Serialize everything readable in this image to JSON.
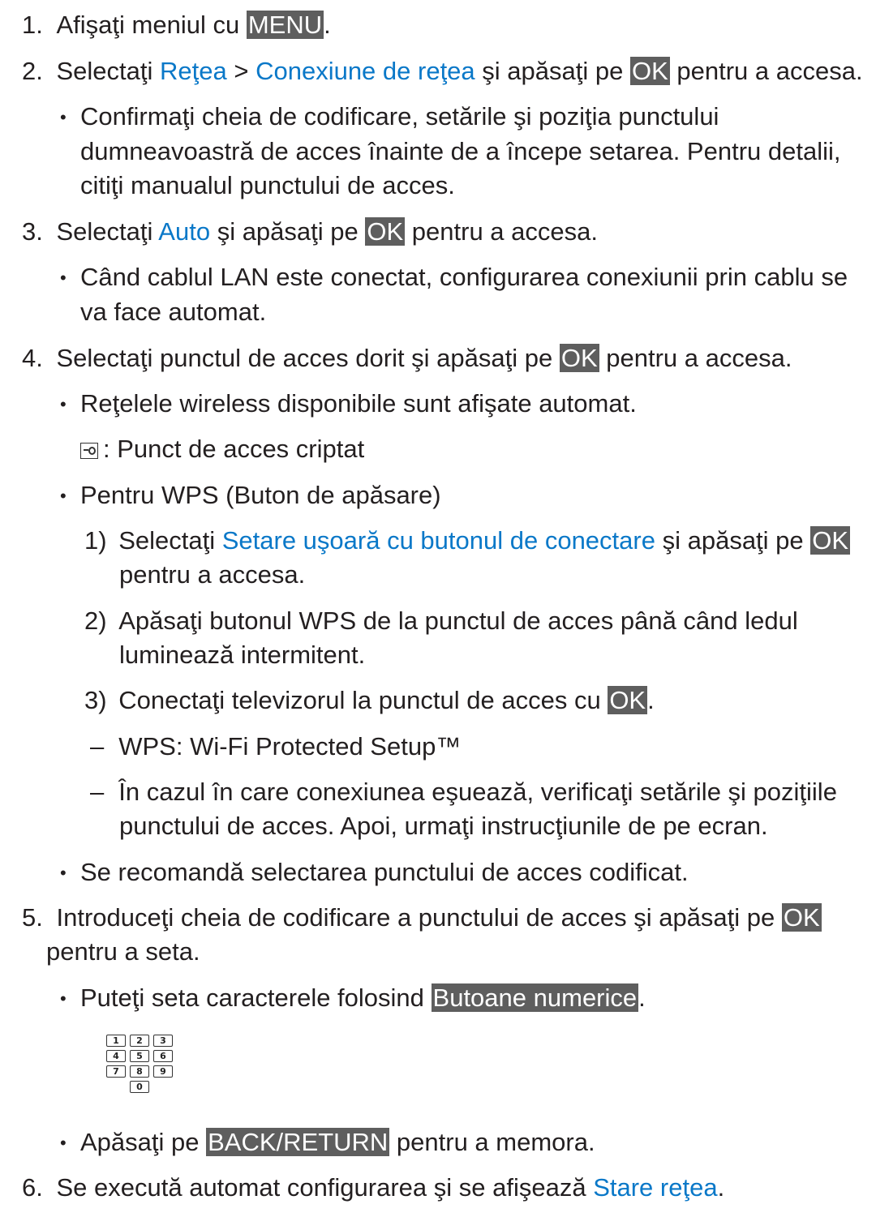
{
  "steps": [
    {
      "n": "1.",
      "pre": "Afişaţi meniul cu ",
      "key": "MENU",
      "post": "."
    },
    {
      "n": "2.",
      "pre": "Selectaţi ",
      "link1": "Reţea",
      "sep": " > ",
      "link2": "Conexiune de reţea",
      "mid": " şi apăsaţi pe ",
      "key": "OK",
      "post": " pentru a accesa."
    },
    {
      "n": "3.",
      "pre": "Selectaţi ",
      "link": "Auto",
      "mid": " şi apăsaţi pe ",
      "key": "OK",
      "post": " pentru a accesa."
    },
    {
      "n": "4.",
      "pre": "Selectaţi punctul de acces dorit şi apăsaţi pe ",
      "key": "OK",
      "post": " pentru a accesa."
    },
    {
      "n": "5.",
      "pre": "Introduceţi cheia de codificare a punctului de acces şi apăsaţi pe ",
      "key": "OK",
      "l2": "pentru a seta."
    },
    {
      "n": "6.",
      "pre": "Se execută automat configurarea şi se afişează ",
      "link": "Stare reţea",
      "post": "."
    }
  ],
  "step2_note": [
    "Confirmaţi cheia de codificare, setările şi poziţia punctului",
    "dumneavoastră de acces înainte de a începe setarea. Pentru detalii,",
    "citiţi manualul punctului de acces."
  ],
  "step3_note": [
    "Când cablul LAN este conectat, configurarea conexiunii prin cablu se",
    "va face automat."
  ],
  "step4": {
    "note1": "Reţelele wireless disponibile sunt afişate automat.",
    "lock_icon": "lock-icon",
    "lock_text": ": Punct de acces criptat",
    "note2": "Pentru WPS (Buton de apăsare)",
    "sub1": {
      "n": "1)",
      "pre": "Selectaţi ",
      "link": "Setare uşoară cu butonul de conectare",
      "mid": " şi apăsaţi pe ",
      "key": "OK",
      "l2": "pentru a accesa."
    },
    "sub2": {
      "n": "2)",
      "l1": "Apăsaţi butonul WPS de la punctul de acces până când ledul",
      "l2": "luminează intermitent."
    },
    "sub3": {
      "n": "3)",
      "pre": "Conectaţi televizorul la punctul de acces cu ",
      "key": "OK",
      "post": "."
    },
    "dash1": "WPS: Wi-Fi Protected Setup™",
    "dash2": [
      "În cazul în care conexiunea eşuează, verificaţi setările şi poziţiile",
      "punctului de acces. Apoi, urmaţi instrucţiunile de pe ecran."
    ],
    "note3": "Se recomandă selectarea punctului de acces codificat."
  },
  "step5": {
    "note1_pre": "Puteţi seta caracterele folosind ",
    "note1_key": "Butoane numerice",
    "note1_post": ".",
    "keypad": [
      "1",
      "2",
      "3",
      "4",
      "5",
      "6",
      "7",
      "8",
      "9",
      "0"
    ],
    "note2_pre": "Apăsaţi pe ",
    "note2_key": "BACK/RETURN",
    "note2_post": " pentru a memora."
  },
  "colors": {
    "link": "#0a78c8",
    "key_bg": "#5e5e5e",
    "text": "#231f20"
  }
}
